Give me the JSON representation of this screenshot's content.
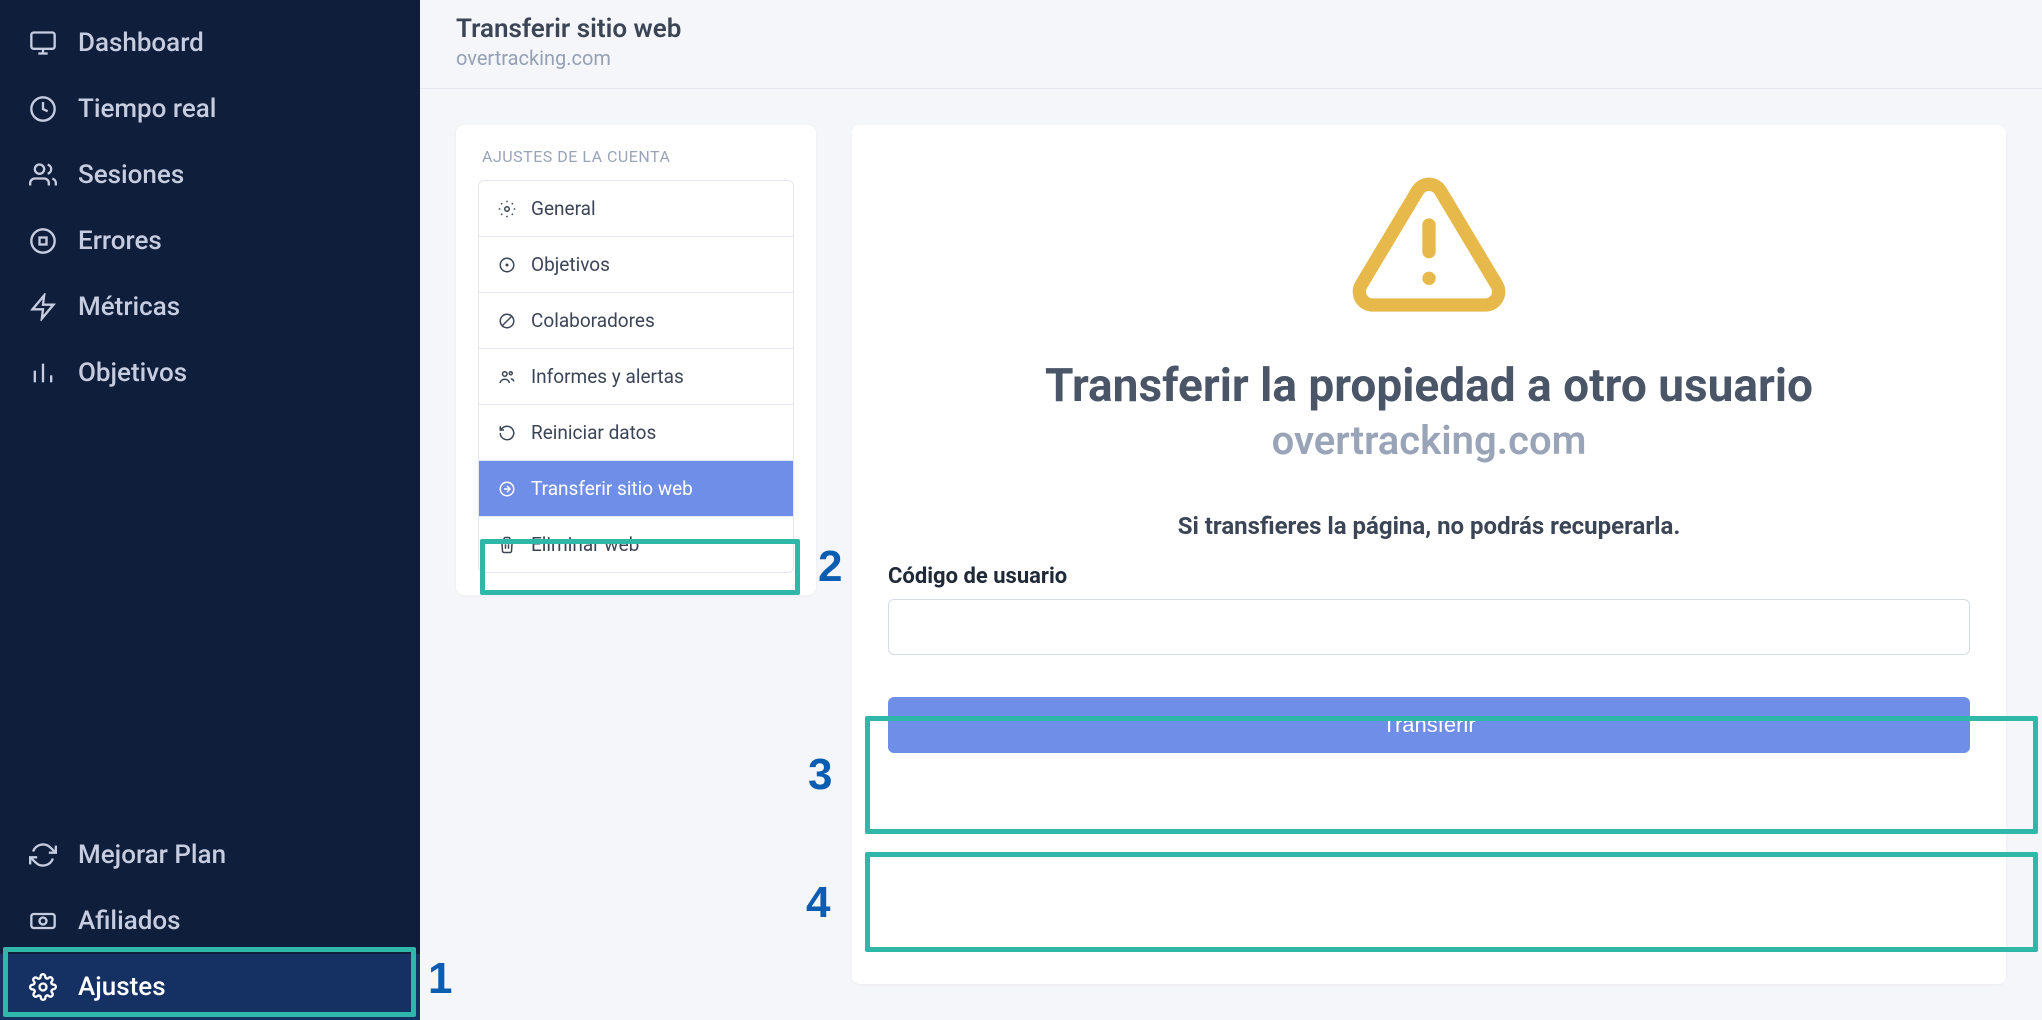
{
  "sidebar": {
    "items": [
      {
        "label": "Dashboard"
      },
      {
        "label": "Tiempo real"
      },
      {
        "label": "Sesiones"
      },
      {
        "label": "Errores"
      },
      {
        "label": "Métricas"
      },
      {
        "label": "Objetivos"
      }
    ],
    "bottom": [
      {
        "label": "Mejorar Plan"
      },
      {
        "label": "Afiliados"
      },
      {
        "label": "Ajustes"
      }
    ]
  },
  "header": {
    "title": "Transferir sitio web",
    "subtitle": "overtracking.com"
  },
  "settings": {
    "title": "AJUSTES DE LA CUENTA",
    "items": [
      {
        "label": "General"
      },
      {
        "label": "Objetivos"
      },
      {
        "label": "Colaboradores"
      },
      {
        "label": "Informes y alertas"
      },
      {
        "label": "Reiniciar datos"
      },
      {
        "label": "Transferir sitio web"
      },
      {
        "label": "Eliminar web"
      }
    ]
  },
  "panel": {
    "title": "Transferir la propiedad a otro usuario",
    "domain": "overtracking.com",
    "warning": "Si transfieres la página, no podrás recuperarla.",
    "input_label": "Código de usuario",
    "button": "Transferir"
  },
  "annotations": {
    "n1": "1",
    "n2": "2",
    "n3": "3",
    "n4": "4"
  }
}
